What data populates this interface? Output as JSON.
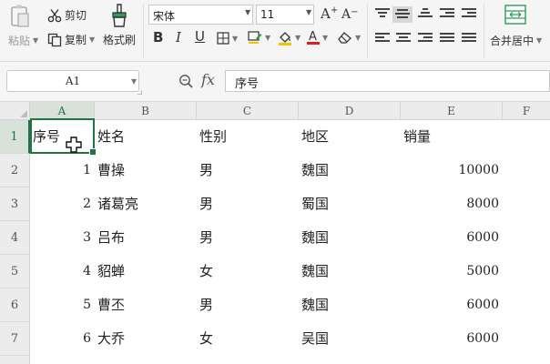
{
  "ribbon": {
    "paste_label": "粘贴",
    "cut_label": "剪切",
    "copy_label": "复制",
    "format_painter_label": "格式刷",
    "font_name": "宋体",
    "font_size": "11",
    "merge_center_label": "合并居中",
    "icons": [
      "paste-icon",
      "scissors-icon",
      "copy-icon",
      "brush-icon",
      "bold-icon",
      "italic-icon",
      "underline-icon",
      "border-icon",
      "fill-color-icon",
      "font-color-icon",
      "eraser-icon",
      "increase-font-icon",
      "decrease-font-icon",
      "merge-icon"
    ],
    "accent_colors": {
      "fill": "#f4c400",
      "font": "#e02020",
      "selection": "#217346"
    }
  },
  "formula_bar": {
    "name_box": "A1",
    "fx_label": "fx",
    "formula_value": "序号"
  },
  "sheet": {
    "columns": [
      "A",
      "B",
      "C",
      "D",
      "E",
      "F"
    ],
    "rows": [
      "1",
      "2",
      "3",
      "4",
      "5",
      "6",
      "7"
    ],
    "header": [
      "序号",
      "姓名",
      "性别",
      "地区",
      "销量"
    ],
    "data": [
      [
        "1",
        "曹操",
        "男",
        "魏国",
        "10000"
      ],
      [
        "2",
        "诸葛亮",
        "男",
        "蜀国",
        "8000"
      ],
      [
        "3",
        "吕布",
        "男",
        "魏国",
        "6000"
      ],
      [
        "4",
        "貂蝉",
        "女",
        "魏国",
        "5000"
      ],
      [
        "5",
        "曹丕",
        "男",
        "魏国",
        "6000"
      ],
      [
        "6",
        "大乔",
        "女",
        "吴国",
        "6000"
      ]
    ]
  }
}
